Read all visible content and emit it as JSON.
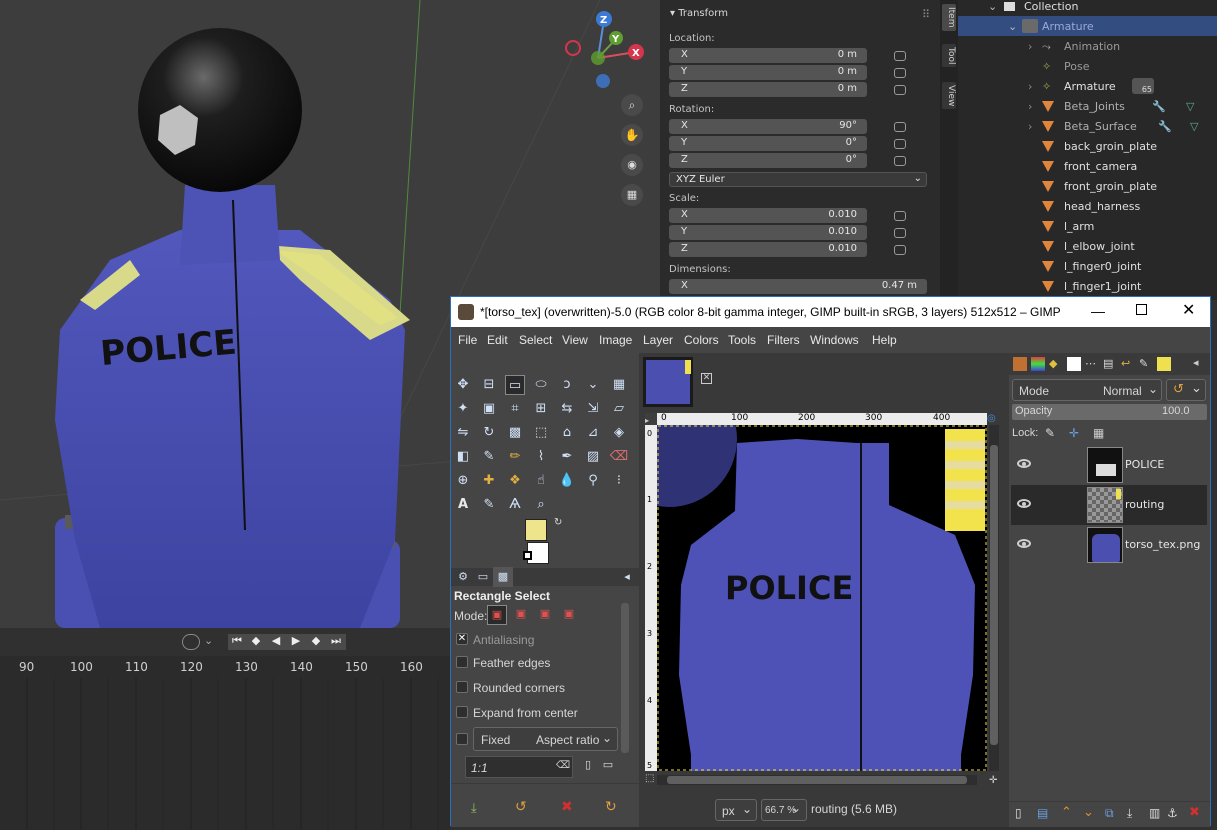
{
  "blender": {
    "transform": {
      "title": "Transform",
      "location_label": "Location:",
      "location": [
        {
          "axis": "X",
          "value": "0 m"
        },
        {
          "axis": "Y",
          "value": "0 m"
        },
        {
          "axis": "Z",
          "value": "0 m"
        }
      ],
      "rotation_label": "Rotation:",
      "rotation": [
        {
          "axis": "X",
          "value": "90°"
        },
        {
          "axis": "Y",
          "value": "0°"
        },
        {
          "axis": "Z",
          "value": "0°"
        }
      ],
      "rotation_mode": "XYZ Euler",
      "scale_label": "Scale:",
      "scale": [
        {
          "axis": "X",
          "value": "0.010"
        },
        {
          "axis": "Y",
          "value": "0.010"
        },
        {
          "axis": "Z",
          "value": "0.010"
        }
      ],
      "dimensions_label": "Dimensions:",
      "dimensions": [
        {
          "axis": "X",
          "value": "0.47 m"
        }
      ]
    },
    "side_tabs": [
      "Item",
      "Tool",
      "View"
    ],
    "gizmo": {
      "z": "Z",
      "y": "Y",
      "x": "X"
    },
    "outliner": {
      "collection": "Collection",
      "items": [
        {
          "label": "Armature",
          "selected": true
        },
        {
          "label": "Animation",
          "muted": true
        },
        {
          "label": "Pose",
          "muted": true
        },
        {
          "label": "Armature",
          "badge": "65"
        },
        {
          "label": "Beta_Joints"
        },
        {
          "label": "Beta_Surface"
        },
        {
          "label": "back_groin_plate"
        },
        {
          "label": "front_camera"
        },
        {
          "label": "front_groin_plate"
        },
        {
          "label": "head_harness"
        },
        {
          "label": "l_arm"
        },
        {
          "label": "l_elbow_joint"
        },
        {
          "label": "l_finger0_joint"
        },
        {
          "label": "l_finger1_joint"
        }
      ]
    },
    "timeline": {
      "frames": [
        "90",
        "100",
        "110",
        "120",
        "130",
        "140",
        "150",
        "160"
      ]
    },
    "viewport_text": "POLICE"
  },
  "gimp": {
    "title": "*[torso_tex] (overwritten)-5.0 (RGB color 8-bit gamma integer, GIMP built-in sRGB, 3 layers) 512x512 – GIMP",
    "menu": [
      "File",
      "Edit",
      "Select",
      "View",
      "Image",
      "Layer",
      "Colors",
      "Tools",
      "Filters",
      "Windows",
      "Help"
    ],
    "tool_options": {
      "title": "Rectangle Select",
      "mode_label": "Mode:",
      "options": [
        "Antialiasing",
        "Feather edges",
        "Rounded corners",
        "Expand from center"
      ],
      "fixed_label": "Fixed",
      "fixed_value": "Aspect ratio",
      "ratio": "1:1"
    },
    "ruler": [
      "0",
      "100",
      "200",
      "300",
      "400"
    ],
    "ruler_v": [
      "0",
      "1",
      "2",
      "3",
      "4",
      "5"
    ],
    "canvas_text": "POLICE",
    "status": {
      "unit": "px",
      "zoom": "66.7 %",
      "info": "routing (5.6 MB)"
    },
    "layers": {
      "mode_label": "Mode",
      "mode_value": "Normal",
      "opacity_label": "Opacity",
      "opacity_value": "100.0",
      "lock_label": "Lock:",
      "items": [
        {
          "name": "POLICE"
        },
        {
          "name": "routing",
          "selected": true
        },
        {
          "name": "torso_tex.png"
        }
      ]
    },
    "colors": {
      "fg": "#ede48b",
      "bg": "#ffffff",
      "jacket": "#4a4fb0"
    }
  }
}
